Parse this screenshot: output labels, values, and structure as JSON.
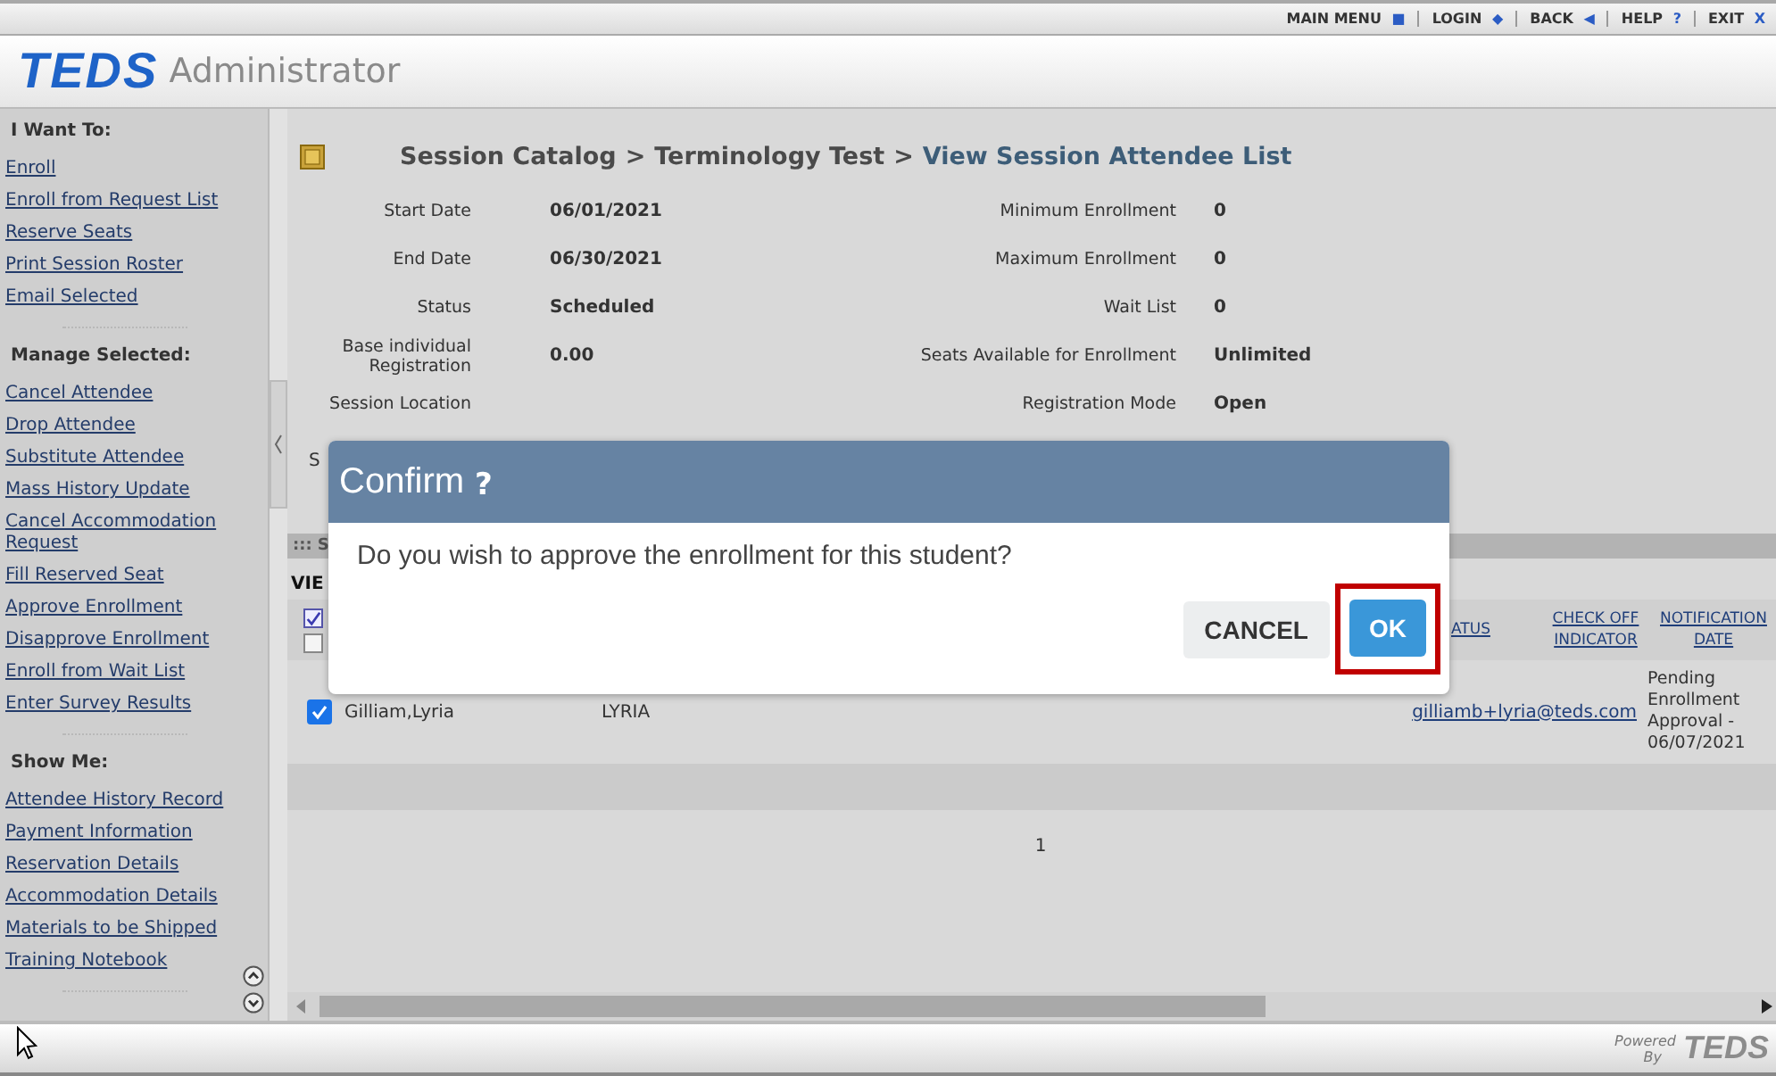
{
  "top_nav": [
    {
      "label": "MAIN MENU",
      "icon": "■"
    },
    {
      "label": "LOGIN",
      "icon": "◆"
    },
    {
      "label": "BACK",
      "icon": "◀"
    },
    {
      "label": "HELP",
      "icon": "?"
    },
    {
      "label": "EXIT",
      "icon": "X"
    }
  ],
  "header": {
    "logo": "TEDS",
    "title": "Administrator"
  },
  "sidebar": {
    "sections": [
      {
        "heading": "I Want To:",
        "items": [
          "Enroll",
          "Enroll from Request List",
          "Reserve Seats",
          "Print Session Roster",
          "Email Selected"
        ]
      },
      {
        "heading": "Manage Selected:",
        "items": [
          "Cancel Attendee",
          "Drop Attendee",
          "Substitute Attendee",
          "Mass History Update",
          "Cancel Accommodation Request",
          "Fill Reserved Seat",
          "Approve Enrollment",
          "Disapprove Enrollment",
          "Enroll from Wait List",
          "Enter Survey Results"
        ]
      },
      {
        "heading": "Show Me:",
        "items": [
          "Attendee History Record",
          "Payment Information",
          "Reservation Details",
          "Accommodation Details",
          "Materials to be Shipped",
          "Training Notebook"
        ]
      }
    ]
  },
  "breadcrumb": [
    {
      "kind": "crumb",
      "label": "Session Catalog"
    },
    {
      "kind": "separator",
      "label": ">"
    },
    {
      "kind": "crumb",
      "label": "Terminology Test"
    },
    {
      "kind": "separator",
      "label": ">"
    },
    {
      "kind": "current",
      "label": "View Session Attendee List"
    }
  ],
  "details": [
    {
      "label": "Start Date",
      "value": "06/01/2021",
      "label_2": "Minimum Enrollment",
      "value_2": "0"
    },
    {
      "label": "End Date",
      "value": "06/30/2021",
      "label_2": "Maximum Enrollment",
      "value_2": "0"
    },
    {
      "label": "Status",
      "value": "Scheduled",
      "label_2": "Wait List",
      "value_2": "0"
    },
    {
      "label": "Base individual Registration",
      "value": "0.00",
      "label_2": "Seats Available for Enrollment",
      "value_2": "Unlimited"
    },
    {
      "label": "Session Location",
      "label_2": "Registration Mode",
      "value_2": "Open"
    }
  ],
  "cut_label": "S",
  "section_bar": "::: S",
  "view_label": "VIE",
  "table": {
    "columns": [
      {
        "kind": "checkbox",
        "checked": true
      },
      {
        "kind": "checkbox",
        "checked": false
      },
      {
        "kind": "link",
        "label": "ATUS"
      },
      {
        "kind": "link",
        "label": "CHECK OFF INDICATOR"
      },
      {
        "kind": "link",
        "label": "NOTIFICATION DATE"
      }
    ],
    "rows": [
      {
        "checked": true,
        "name": "Gilliam,Lyria",
        "column_3": "LYRIA",
        "email": "gilliamb+lyria@teds.com",
        "status": "Pending Enrollment Approval - 06/07/2021"
      }
    ]
  },
  "pagination": "1",
  "footer": {
    "powered": "Powered",
    "by": "By",
    "logo": "TEDS"
  },
  "dialog": {
    "title": "Confirm",
    "title_icon": "?",
    "message": "Do you wish to approve the enrollment for this student?",
    "buttons": [
      {
        "label": "CANCEL",
        "kind": "secondary",
        "highlighted": false
      },
      {
        "label": "OK",
        "kind": "primary",
        "highlighted": true
      }
    ]
  }
}
